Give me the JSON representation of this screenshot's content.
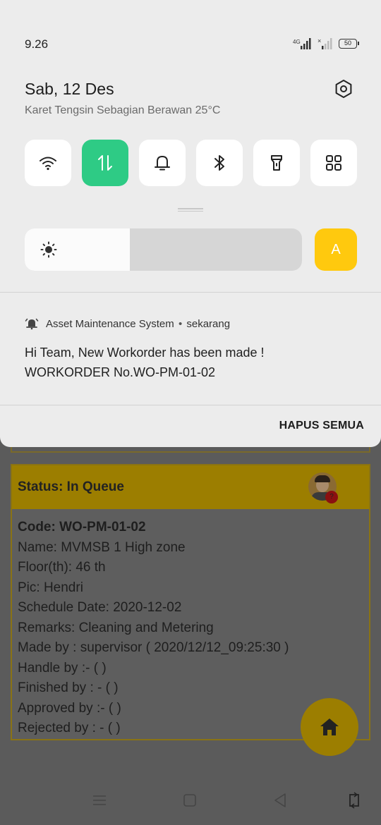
{
  "status_bar": {
    "time": "9.26",
    "network": "4G",
    "battery": "50"
  },
  "panel": {
    "date": "Sab, 12 Des",
    "weather": "Karet Tengsin Sebagian Berawan 25°C",
    "tiles": [
      {
        "name": "wifi-icon",
        "active": false
      },
      {
        "name": "mobile-data-icon",
        "active": true
      },
      {
        "name": "bell-icon",
        "active": false
      },
      {
        "name": "bluetooth-icon",
        "active": false
      },
      {
        "name": "flashlight-icon",
        "active": false
      },
      {
        "name": "apps-grid-icon",
        "active": false
      }
    ],
    "brightness_level": 0.38,
    "auto_brightness_label": "A",
    "accent_color": "#2ecb85",
    "auto_color": "#ffc90e"
  },
  "notification": {
    "app_name": "Asset Maintenance System",
    "separator": "•",
    "time": "sekarang",
    "line1": "Hi Team, New Workorder has been made !",
    "line2": "WORKORDER No.WO-PM-01-02"
  },
  "clear_all_label": "HAPUS SEMUA",
  "workorder": {
    "status": "Status: In Queue",
    "code": "Code: WO-PM-01-02",
    "name": "Name: MVMSB 1 High zone",
    "floor": "Floor(th): 46 th",
    "pic": "Pic: Hendri",
    "schedule": "Schedule Date: 2020-12-02",
    "remarks": "Remarks: Cleaning and Metering",
    "made_by": "Made by : supervisor ( 2020/12/12_09:25:30 )",
    "handle_by": "Handle by :- (  )",
    "finished_by": "Finished by : - (  )",
    "approved_by": "Approved by :- (  )",
    "rejected_by": "Rejected by : - (  )",
    "header_color": "#9c7e00"
  },
  "nav": {
    "icons": [
      "menu-icon",
      "home-square-icon",
      "back-icon",
      "rotate-icon"
    ]
  }
}
